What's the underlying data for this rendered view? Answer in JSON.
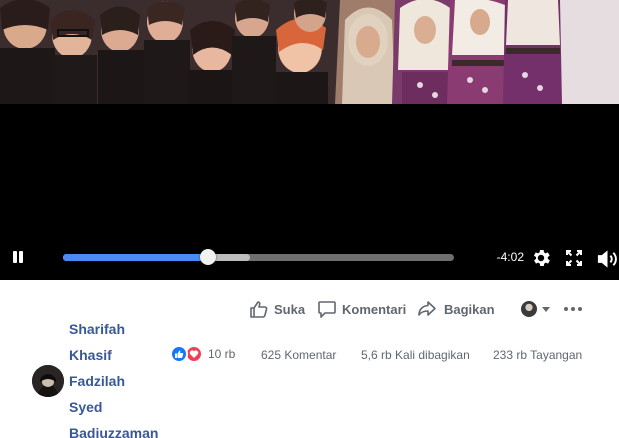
{
  "player": {
    "time_remaining": "-4:02",
    "progress_fraction": 0.371,
    "buffered_fraction": 0.478
  },
  "actions": {
    "like_label": "Suka",
    "comment_label": "Komentari",
    "share_label": "Bagikan"
  },
  "post": {
    "author_lines": [
      "Sharifah",
      "Khasif",
      "Fadzilah",
      "Syed",
      "Badiuzzaman"
    ],
    "reaction_count": "10 rb",
    "comments": "625 Komentar",
    "shares": "5,6 rb Kali dibagikan",
    "views": "233 rb Tayangan"
  },
  "colors": {
    "progress_played": "#4a8af4",
    "link_name": "#385898",
    "meta_text": "#606770",
    "like_blue": "#1877f2",
    "love_red": "#f33e58"
  }
}
